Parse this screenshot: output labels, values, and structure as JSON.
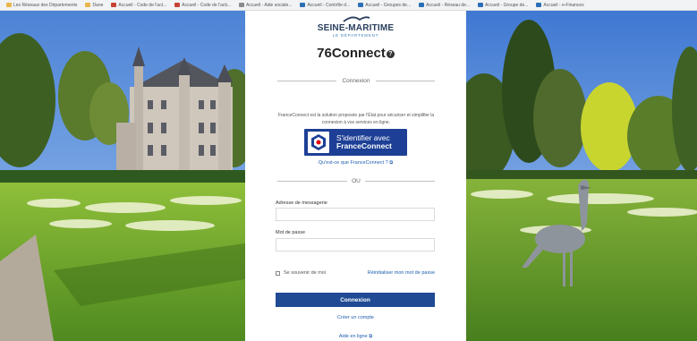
{
  "bookmarks": [
    {
      "label": "Les Réseaux des Départements",
      "icon": "folder-icon",
      "color": "folder"
    },
    {
      "label": "Dane",
      "icon": "folder-icon",
      "color": "folder"
    },
    {
      "label": "Accueil - Code de l'act...",
      "icon": "bookmark-icon",
      "color": "red"
    },
    {
      "label": "Accueil - Code de l'acti...",
      "icon": "bookmark-icon",
      "color": "red"
    },
    {
      "label": "Accueil - Aide sociale...",
      "icon": "bookmark-icon",
      "color": "grey"
    },
    {
      "label": "Accueil - Contrôle d...",
      "icon": "bookmark-icon",
      "color": "blue"
    },
    {
      "label": "Accueil - Groupes de...",
      "icon": "bookmark-icon",
      "color": "blue"
    },
    {
      "label": "Accueil - Réseau de...",
      "icon": "bookmark-icon",
      "color": "blue"
    },
    {
      "label": "Accueil - Groupe de...",
      "icon": "bookmark-icon",
      "color": "blue"
    },
    {
      "label": "Accueil - e-Finances",
      "icon": "bookmark-icon",
      "color": "blue"
    }
  ],
  "brand": {
    "name": "SEINE-MARITIME",
    "subtitle": "LE DÉPARTEMENT",
    "logo_icon": "seine-maritime-logo-icon"
  },
  "app_title": "76Connect",
  "help_icon": "help-circle-icon",
  "divider_connexion": "Connexion",
  "franceconnect": {
    "intro": "FranceConnect est la solution proposée par l'État pour sécuriser et simplifier la connexion à vos services en ligne.",
    "button_line1": "S'identifier avec",
    "button_line2": "FranceConnect",
    "what_link": "Qu'est-ce que FranceConnect ? ⧉"
  },
  "divider_or": "OU",
  "form": {
    "email_label": "Adresse de messagerie",
    "email_value": "",
    "password_label": "Mot de passe",
    "password_value": "",
    "remember_label": "Se souvenir de moi",
    "reset_link": "Réinitialiser mon mot de passe",
    "submit_label": "Connexion"
  },
  "create_account": "Créer un compte",
  "online_help": "Aide en ligne ⧉",
  "colors": {
    "primary": "#204b94",
    "franceconnect_blue": "#1d3f95",
    "link": "#2060b0",
    "brand_text": "#2a3f5e"
  }
}
